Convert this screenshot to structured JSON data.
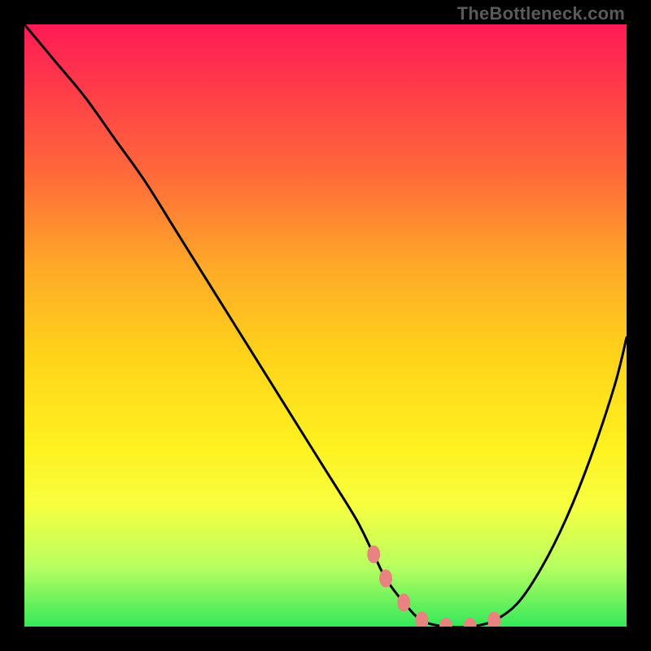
{
  "watermark": "TheBottleneck.com",
  "chart_data": {
    "type": "line",
    "title": "",
    "xlabel": "",
    "ylabel": "",
    "xlim": [
      0,
      100
    ],
    "ylim": [
      0,
      100
    ],
    "series": [
      {
        "name": "curve",
        "x": [
          0,
          5,
          10,
          15,
          20,
          25,
          30,
          35,
          40,
          45,
          50,
          55,
          58,
          60,
          63,
          66,
          70,
          74,
          78,
          82,
          86,
          90,
          94,
          98,
          100
        ],
        "y": [
          100,
          94,
          88,
          81,
          74,
          66,
          58,
          50,
          42,
          34,
          26,
          18,
          12,
          8,
          4,
          1,
          0,
          0,
          1,
          4,
          10,
          18,
          28,
          40,
          48
        ]
      },
      {
        "name": "highlight-dots",
        "x": [
          58,
          60,
          63,
          66,
          70,
          74,
          78
        ],
        "y": [
          12,
          8,
          4,
          1,
          0,
          0,
          1
        ]
      }
    ],
    "gradient_stops": [
      {
        "pos": 0,
        "color": "#ff1a55"
      },
      {
        "pos": 55,
        "color": "#ffd31a"
      },
      {
        "pos": 100,
        "color": "#35e85a"
      }
    ]
  }
}
